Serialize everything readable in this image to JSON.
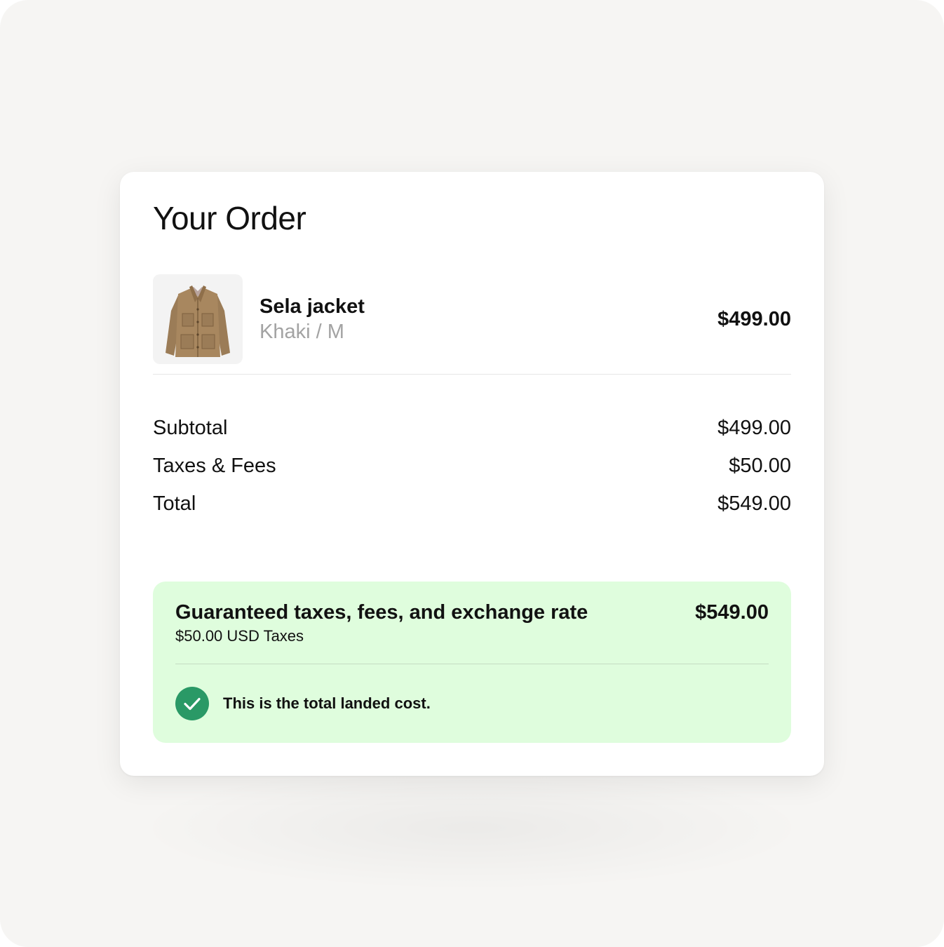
{
  "order": {
    "title": "Your Order",
    "item": {
      "image_icon": "jacket-icon",
      "name": "Sela jacket",
      "variant": "Khaki / M",
      "price": "$499.00"
    },
    "summary": [
      {
        "label": "Subtotal",
        "value": "$499.00"
      },
      {
        "label": "Taxes & Fees",
        "value": "$50.00"
      },
      {
        "label": "Total",
        "value": "$549.00"
      }
    ]
  },
  "guarantee": {
    "title": "Guaranteed taxes, fees, and exchange rate",
    "subtitle": "$50.00 USD Taxes",
    "amount": "$549.00",
    "note": "This is the total landed cost.",
    "icon": "check-circle-icon"
  },
  "colors": {
    "page_background": "#f6f5f3",
    "card_background": "#ffffff",
    "guarantee_background": "#dffddd",
    "check_green": "#2a9966",
    "muted_text": "#a3a3a3"
  }
}
